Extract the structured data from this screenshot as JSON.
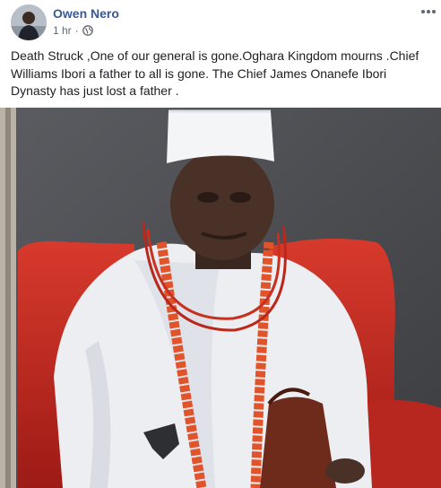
{
  "post": {
    "author": "Owen Nero",
    "time": "1 hr",
    "separator": "·",
    "privacy_icon": "globe-icon",
    "more_icon": "more-options-icon",
    "text": "Death Struck ,One of our general is gone.Oghara Kingdom mourns .Chief Williams Ibori a father to all is gone. The Chief James Onanefe Ibori Dynasty has just lost a father ."
  },
  "colors": {
    "author_link": "#385898",
    "meta_text": "#616770",
    "body_text": "#1c1e21",
    "photo_background": "#4a4b4f",
    "chair_red": "#c8241e",
    "robe_white": "#eef0f4",
    "coral_beads": "#e0532b"
  }
}
